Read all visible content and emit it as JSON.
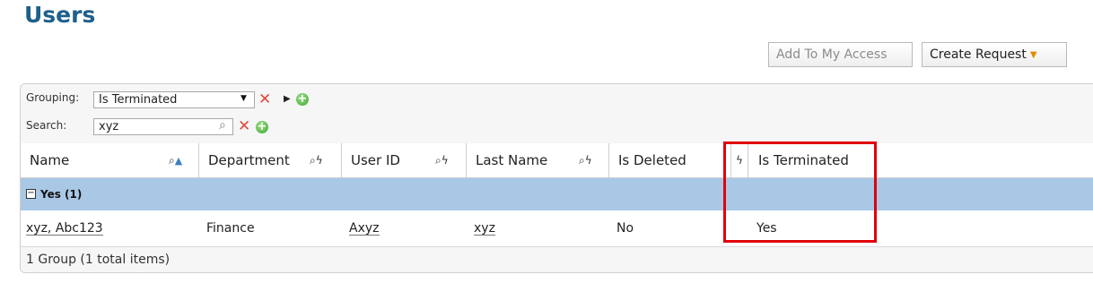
{
  "page": {
    "title": "Users"
  },
  "actions": {
    "add_to_access": "Add To My Access",
    "create_request": "Create Request",
    "create_request_arrow": "▼"
  },
  "toolbar": {
    "grouping_label": "Grouping:",
    "grouping_value": "Is Terminated",
    "search_label": "Search:",
    "search_value": "xyz"
  },
  "columns": [
    {
      "label": "Name"
    },
    {
      "label": "Department"
    },
    {
      "label": "User ID"
    },
    {
      "label": "Last Name"
    },
    {
      "label": "Is Deleted"
    },
    {
      "label": "Is Terminated"
    }
  ],
  "group": {
    "label": "Yes (1)",
    "toggle": "−"
  },
  "rows": [
    {
      "name": "xyz, Abc123",
      "department": "Finance",
      "user_id": "Axyz",
      "last_name": "xyz",
      "is_deleted": "No",
      "is_terminated": "Yes"
    }
  ],
  "footer": {
    "summary": "1 Group (1 total items)"
  },
  "icons": {
    "dropdown": "▼",
    "remove": "✕",
    "play": "▶",
    "add": "+",
    "search": "⌕",
    "sort_asc": "▲",
    "filter": "ϟ"
  },
  "colors": {
    "title": "#1f5f8b",
    "group_band": "#a9c8e6",
    "highlight": "#e0000b",
    "remove": "#e0483a",
    "add": "#3fa534"
  }
}
